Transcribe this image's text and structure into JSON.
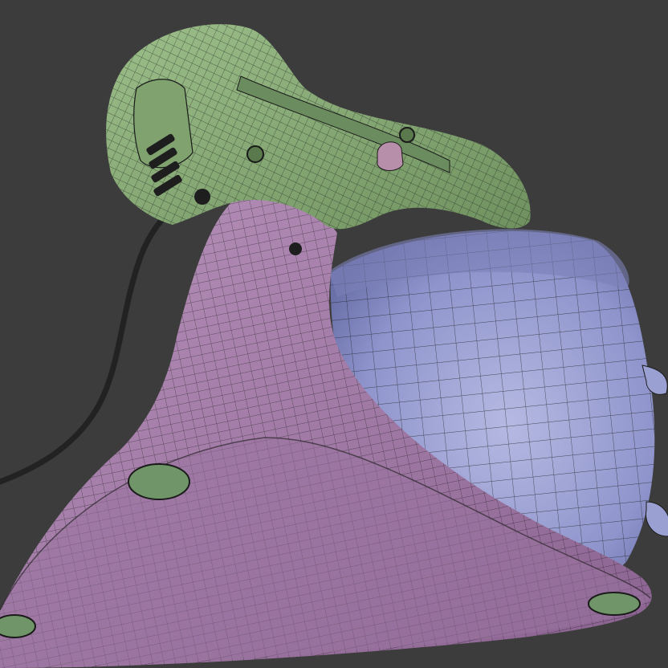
{
  "scene": {
    "subject": "stand-mixer-wireframe",
    "colors": {
      "background": "#3c3c3c",
      "head": "#8fb07e",
      "head_shade": "#5f7e55",
      "base": "#a27aa6",
      "base_shade": "#7a5580",
      "bowl": "#9aa0d2",
      "bowl_shade": "#6f74aa",
      "cord": "#222222",
      "wire": "#1a1a1a",
      "foot": "#6f9568"
    }
  }
}
